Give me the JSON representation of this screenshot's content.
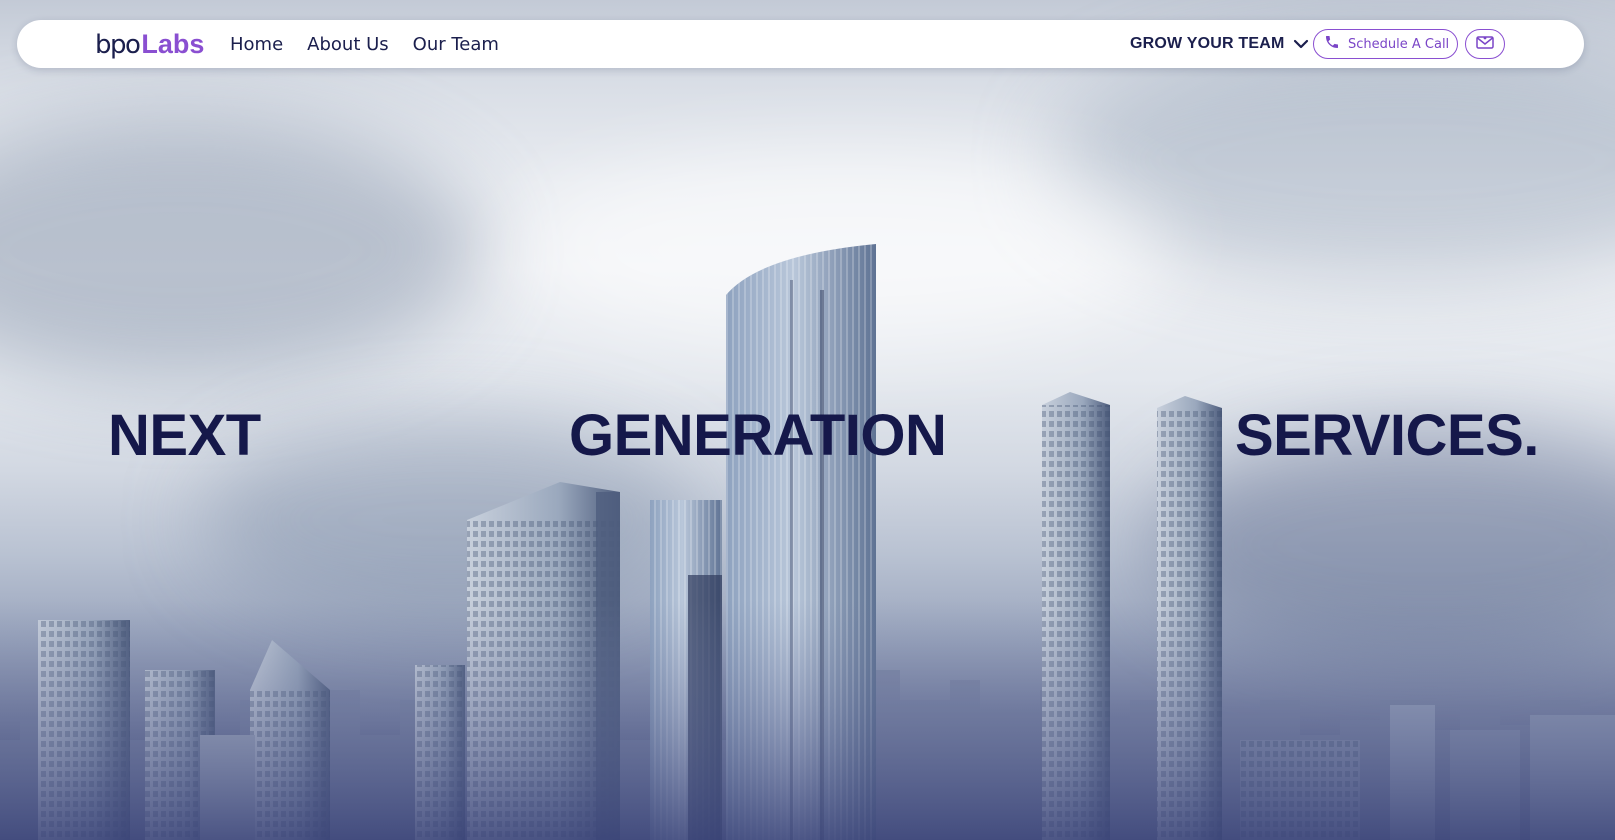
{
  "brand": {
    "logo_part1": "bpo",
    "logo_part2": "Labs",
    "accent": "#8a4fd1",
    "navy": "#1b1f4d"
  },
  "nav": {
    "links": [
      {
        "label": "Home"
      },
      {
        "label": "About Us"
      },
      {
        "label": "Our Team"
      }
    ],
    "dropdown_label": "GROW YOUR TEAM",
    "dropdown_icon": "chevron-down-icon",
    "call_button_label": "Schedule A Call",
    "call_icon": "phone-icon",
    "mail_icon": "mail-icon"
  },
  "hero": {
    "headline_words": [
      "NEXT",
      "GENERATION",
      "SERVICES."
    ],
    "headline_color": "#15184a",
    "background": "city-skyline-image"
  }
}
